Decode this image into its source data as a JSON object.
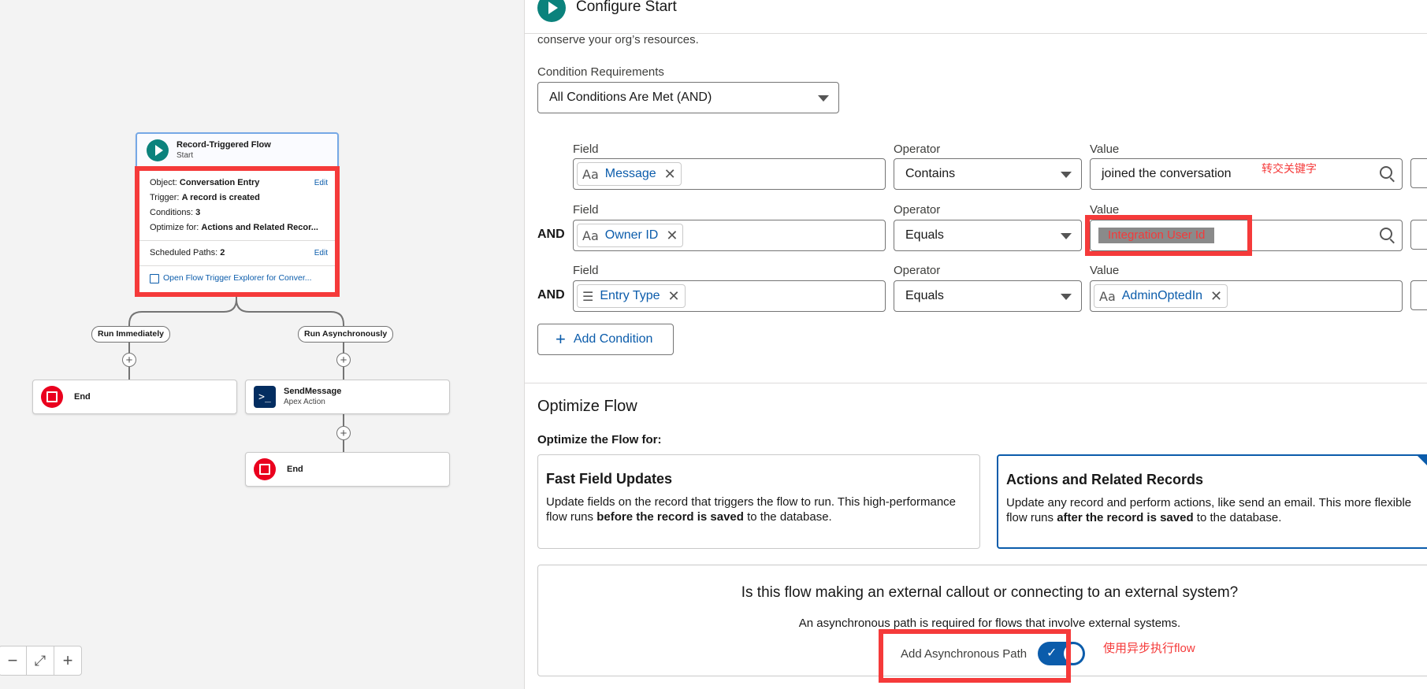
{
  "canvas": {
    "start_node": {
      "title": "Record-Triggered Flow",
      "subtitle": "Start",
      "object_label": "Object:",
      "object_value": "Conversation Entry",
      "trigger_label": "Trigger:",
      "trigger_value": "A record is created",
      "conditions_label": "Conditions:",
      "conditions_value": "3",
      "optimize_label": "Optimize for:",
      "optimize_value": "Actions and Related Recor...",
      "scheduled_label": "Scheduled Paths:",
      "scheduled_value": "2",
      "edit_label": "Edit",
      "explorer_link": "Open Flow Trigger Explorer for Conver..."
    },
    "path_immediate": "Run Immediately",
    "path_async": "Run Asynchronously",
    "end_label": "End",
    "send_message": {
      "title": "SendMessage",
      "subtitle": "Apex Action"
    },
    "zoom": {
      "minus": "−",
      "fit": "⤢",
      "plus": "+"
    }
  },
  "panel": {
    "title": "Configure Start",
    "intro_tail": "conserve your org’s resources.",
    "condition_requirements_label": "Condition Requirements",
    "condition_requirements_value": "All Conditions Are Met (AND)",
    "col_field": "Field",
    "col_operator": "Operator",
    "col_value": "Value",
    "and_label": "AND",
    "conditions": [
      {
        "field": "Message",
        "operator": "Contains",
        "value": "joined the conversation"
      },
      {
        "field": "Owner ID",
        "operator": "Equals",
        "value": "Integration User Id"
      },
      {
        "field": "Entry Type",
        "operator": "Equals",
        "value": "AdminOptedIn"
      }
    ],
    "add_condition": "Add Condition",
    "optimize_heading": "Optimize Flow",
    "optimize_for_label": "Optimize the Flow for:",
    "options": [
      {
        "title": "Fast Field Updates",
        "desc_pre": "Update fields on the record that triggers the flow to run. This high-performance flow runs ",
        "desc_bold": "before the record is saved",
        "desc_post": " to the database."
      },
      {
        "title": "Actions and Related Records",
        "desc_pre": "Update any record and perform actions, like send an email. This more flexible flow runs ",
        "desc_bold": "after the record is saved",
        "desc_post": " to the database."
      }
    ],
    "external_question": "Is this flow making an external callout or connecting to an external system?",
    "external_note": "An asynchronous path is required for flows that involve external systems.",
    "async_toggle_label": "Add Asynchronous Path",
    "async_toggle_on": true
  },
  "annotations": {
    "keyword": "转交关键字",
    "async": "使用异步执行flow"
  },
  "colors": {
    "accent": "#0b5cab",
    "start_green": "#0b827c",
    "end_red": "#ea001e",
    "annotation_red": "#f53a3a"
  }
}
